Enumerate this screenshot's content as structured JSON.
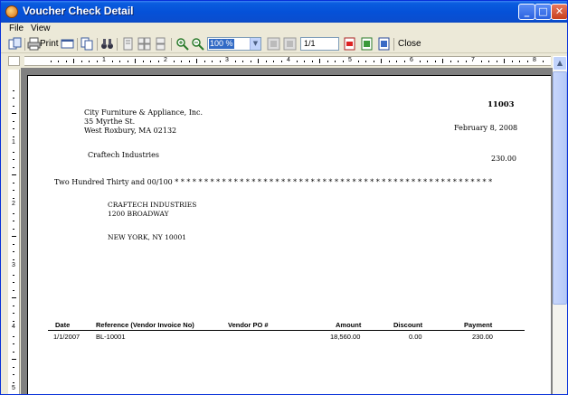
{
  "window": {
    "title": "Voucher Check Detail",
    "controls": {
      "minimize": "_",
      "maximize": "□",
      "close": "✕"
    }
  },
  "menu": {
    "file": "File",
    "view": "View"
  },
  "toolbar": {
    "print_label": "Print",
    "zoom_value": "100 %",
    "page_value": "1/1",
    "close_label": "Close"
  },
  "ruler": {
    "h_numbers": [
      "1",
      "2",
      "3",
      "4",
      "5",
      "6",
      "7",
      "8"
    ],
    "v_numbers": [
      "1",
      "2",
      "3",
      "4",
      "5"
    ]
  },
  "check": {
    "number": "11003",
    "company": {
      "name": "City Furniture & Appliance, Inc.",
      "address1": "35 Myrthe St.",
      "address2": "West Roxbury, MA 02132"
    },
    "date": "February 8, 2008",
    "payee": "Craftech Industries",
    "amount": "230.00",
    "amount_words": "Two Hundred Thirty and 00/100 * * * * * * * * * * * * * * * * * * * * * * * * * * * * * * * * * * * * * * * * * * * * * * * * * * * * * *",
    "mail_to": {
      "line1": "CRAFTECH INDUSTRIES",
      "line2": "1200 BROADWAY",
      "line3": "NEW YORK, NY 10001"
    }
  },
  "detail_table": {
    "headers": {
      "date": "Date",
      "reference": "Reference (Vendor Invoice No)",
      "vendor_po": "Vendor PO #",
      "amount": "Amount",
      "discount": "Discount",
      "payment": "Payment"
    },
    "rows": [
      {
        "date": "1/1/2007",
        "reference": "BL-10001",
        "vendor_po": "",
        "amount": "18,560.00",
        "discount": "0.00",
        "payment": "230.00"
      }
    ]
  }
}
